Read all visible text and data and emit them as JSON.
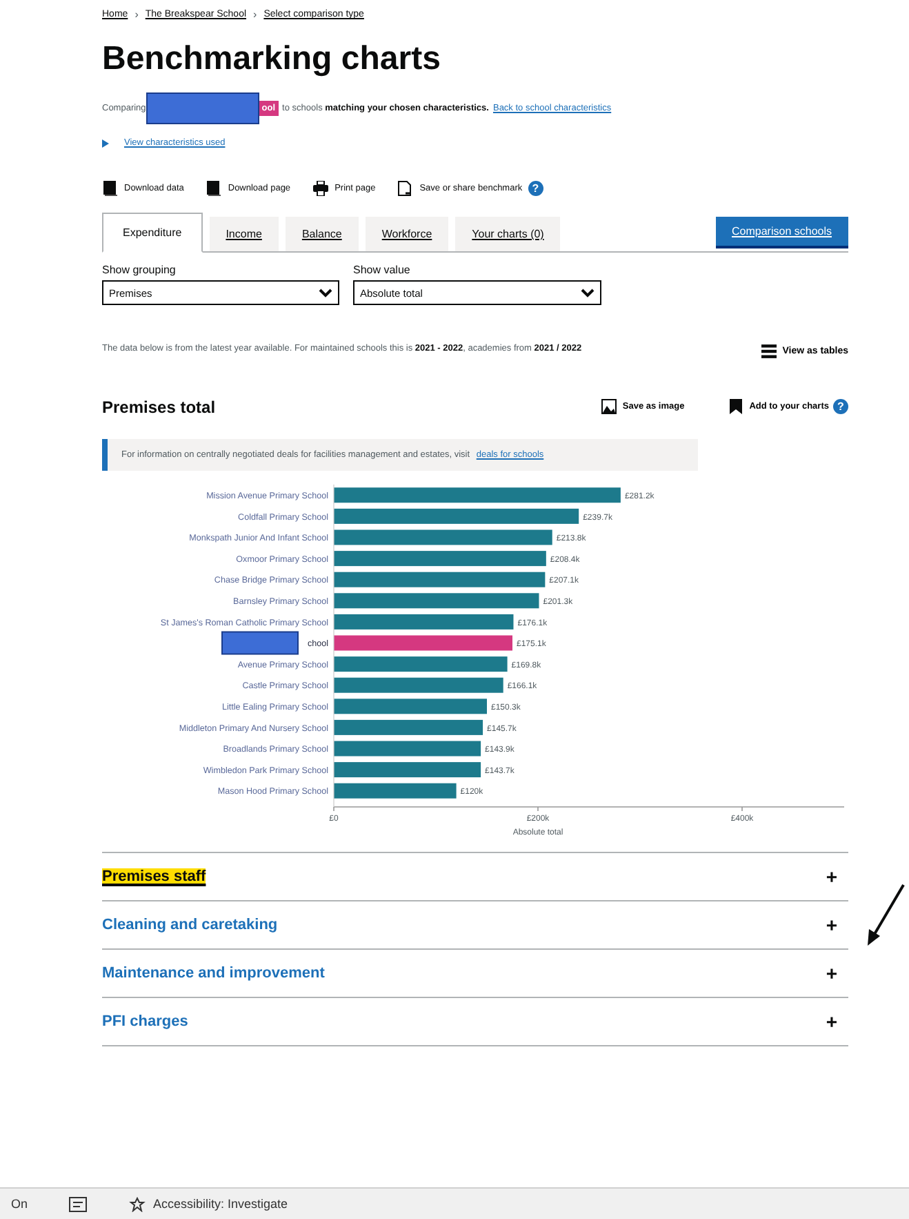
{
  "breadcrumbs": [
    "Home",
    "The Breakspear School",
    "Select comparison type"
  ],
  "breadcrumb_separator": "›",
  "title": "Benchmarking charts",
  "intro": {
    "prefix": "Comparing",
    "highlight": "ool",
    "text": "to schools **matching your chosen characteristics.**",
    "link": "Back to school characteristics"
  },
  "details": {
    "label": "View characteristics used",
    "expanded": false
  },
  "actions": [
    {
      "kind": "download",
      "label": "Download data"
    },
    {
      "kind": "download",
      "label": "Download page"
    },
    {
      "kind": "print",
      "label": "Print page"
    },
    {
      "kind": "share",
      "label": "Save or share benchmark",
      "help": "?"
    }
  ],
  "tabs": [
    {
      "label": "Expenditure",
      "selected": true
    },
    {
      "label": "Income",
      "selected": false
    },
    {
      "label": "Balance",
      "selected": false
    },
    {
      "label": "Workforce",
      "selected": false
    },
    {
      "label": "Your charts (0)",
      "selected": false
    }
  ],
  "comparison_button": "Comparison schools",
  "selects": [
    {
      "label": "Show grouping",
      "value": "Premises"
    },
    {
      "label": "Show value",
      "value": "Absolute total"
    }
  ],
  "notice": "The data below is from the latest year available. For maintained schools this is **2021 - 2022**, academies from **2021 / 2022**",
  "view_tables": "View as tables",
  "section": {
    "title": "Premises total",
    "save": "Save as image",
    "add": "Add to your charts",
    "help": "?",
    "inset": "For information on centrally negotiated deals for facilities management and estates, visit",
    "inset_link": "deals for schools",
    "redacted_rows": [
      false,
      false,
      false,
      false,
      false,
      false,
      false,
      true,
      false,
      false,
      false,
      false,
      false,
      false,
      false
    ],
    "chart_data": {
      "type": "bar",
      "orientation": "horizontal",
      "stacked": true,
      "xlabel": "Absolute total",
      "categories": [
        "Mission Avenue Primary School",
        "Coldfall Primary School",
        "Monkspath Junior And Infant School",
        "Oxmoor Primary School",
        "Chase Bridge Primary School",
        "Barnsley Primary School",
        "St James's Roman Catholic Primary School",
        "chool",
        "Avenue Primary School",
        "Castle Primary School",
        "Little Ealing Primary School",
        "Middleton Primary And Nursery School",
        "Broadlands Primary School",
        "Wimbledon Park Primary School",
        "Mason Hood Primary School"
      ],
      "value_labels": [
        "£281.2k",
        "£239.7k",
        "£213.8k",
        "£208.4k",
        "£207.1k",
        "£201.3k",
        "£176.1k",
        "£175.1k",
        "£169.8k",
        "£166.1k",
        "£150.3k",
        "£145.7k",
        "£143.9k",
        "£143.7k",
        "£120k"
      ],
      "series": [
        {
          "color": "#1d7a8c",
          "values": [
            281,
            240,
            214,
            208,
            207,
            201,
            176,
            null,
            170,
            166,
            150,
            146,
            144,
            144,
            120
          ]
        },
        {
          "color": "#d53880",
          "values": [
            null,
            null,
            null,
            null,
            null,
            null,
            null,
            175,
            null,
            null,
            null,
            null,
            null,
            null,
            null
          ]
        }
      ],
      "xlim": [
        0,
        500
      ],
      "xticks": [
        {
          "value": 0,
          "label": "£0"
        },
        {
          "value": 200,
          "label": "£200k"
        },
        {
          "value": 400,
          "label": "£400k"
        }
      ]
    }
  },
  "accordion": [
    {
      "title": "Premises staff",
      "highlighted": true,
      "toggle": "+"
    },
    {
      "title": "Cleaning and caretaking",
      "highlighted": false,
      "toggle": "+"
    },
    {
      "title": "Maintenance and improvement",
      "highlighted": false,
      "toggle": "+"
    },
    {
      "title": "PFI charges",
      "highlighted": false,
      "toggle": "+"
    }
  ],
  "status_bar": [
    "On",
    "Accessibility: Investigate"
  ]
}
